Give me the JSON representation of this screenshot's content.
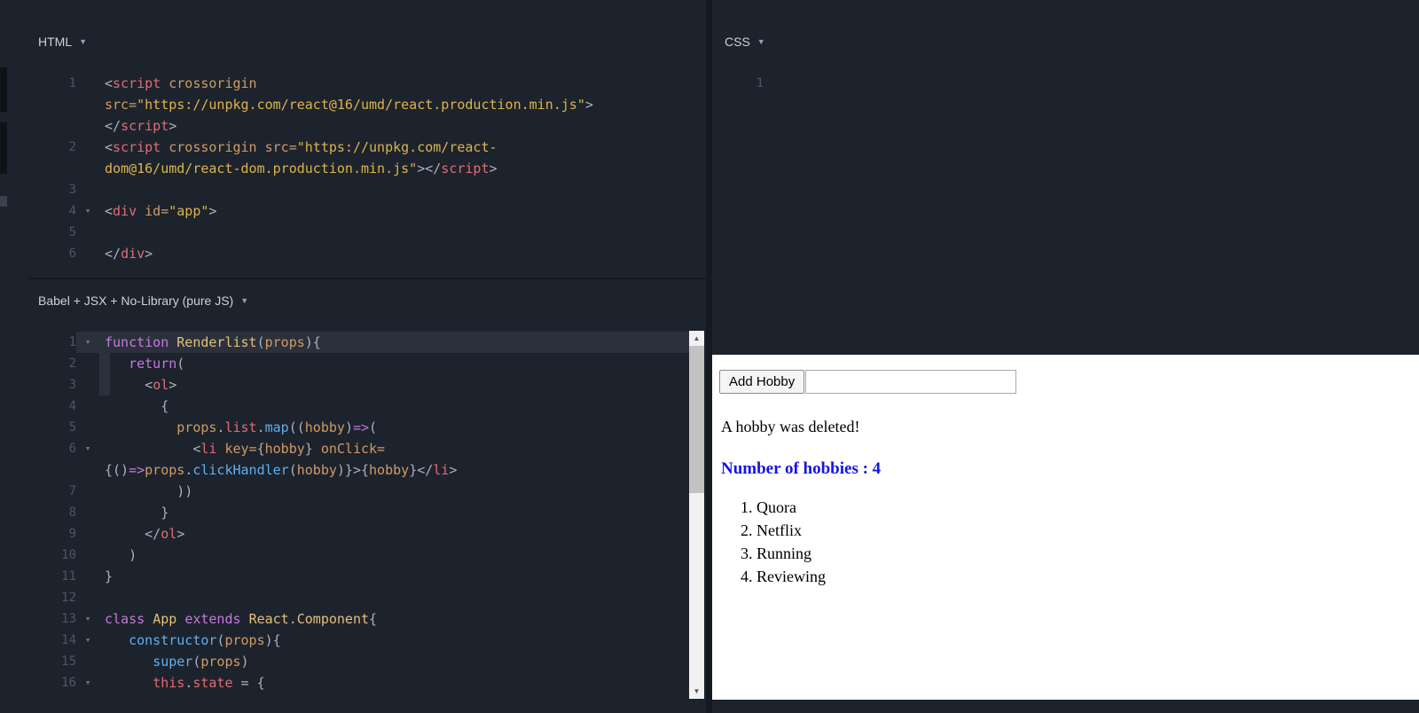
{
  "icons": {
    "dropdown": "▼",
    "fold": "▾",
    "scroll_up": "▲",
    "scroll_down": "▼"
  },
  "colors": {
    "count_text": "#1414e0",
    "syntax": {
      "pln": "#abb2bf",
      "tag": "#e06c75",
      "atr": "#d19a66",
      "str": "#ddb44d",
      "kw": "#c678dd",
      "def": "#e5c07b",
      "fn": "#61afef",
      "prop": "#e06c75"
    }
  },
  "panels": {
    "html": {
      "title": "HTML"
    },
    "css": {
      "title": "CSS"
    },
    "js": {
      "title": "Babel + JSX + No-Library (pure JS)"
    }
  },
  "editors": {
    "html": {
      "lines": [
        {
          "num": "1",
          "tokens": [
            [
              "pln",
              "<"
            ],
            [
              "tag",
              "script"
            ],
            [
              "pln",
              " "
            ],
            [
              "atr",
              "crossorigin"
            ]
          ]
        },
        {
          "num": "",
          "tokens": [
            [
              "atr",
              "src="
            ],
            [
              "str",
              "\"https://unpkg.com/react@16/umd/react.production.min.js\""
            ],
            [
              "pln",
              ">"
            ]
          ]
        },
        {
          "num": "",
          "tokens": [
            [
              "pln",
              "</"
            ],
            [
              "tag",
              "script"
            ],
            [
              "pln",
              ">"
            ]
          ]
        },
        {
          "num": "2",
          "tokens": [
            [
              "pln",
              "<"
            ],
            [
              "tag",
              "script"
            ],
            [
              "pln",
              " "
            ],
            [
              "atr",
              "crossorigin"
            ],
            [
              "pln",
              " "
            ],
            [
              "atr",
              "src="
            ],
            [
              "str",
              "\"https://unpkg.com/react-"
            ]
          ]
        },
        {
          "num": "",
          "tokens": [
            [
              "str",
              "dom@16/umd/react-dom.production.min.js\""
            ],
            [
              "pln",
              "></"
            ],
            [
              "tag",
              "script"
            ],
            [
              "pln",
              ">"
            ]
          ]
        },
        {
          "num": "3",
          "tokens": []
        },
        {
          "num": "4",
          "fold": true,
          "tokens": [
            [
              "pln",
              "<"
            ],
            [
              "tag",
              "div"
            ],
            [
              "pln",
              " "
            ],
            [
              "atr",
              "id="
            ],
            [
              "str",
              "\"app\""
            ],
            [
              "pln",
              ">"
            ]
          ]
        },
        {
          "num": "5",
          "tokens": []
        },
        {
          "num": "6",
          "tokens": [
            [
              "pln",
              "</"
            ],
            [
              "tag",
              "div"
            ],
            [
              "pln",
              ">"
            ]
          ]
        }
      ]
    },
    "css": {
      "lines": [
        {
          "num": "1",
          "tokens": []
        }
      ]
    },
    "js": {
      "lines": [
        {
          "num": "1",
          "fold": true,
          "active": true,
          "tokens": [
            [
              "kw",
              "function"
            ],
            [
              "pln",
              " "
            ],
            [
              "def",
              "Renderlist"
            ],
            [
              "pln",
              "("
            ],
            [
              "atr",
              "props"
            ],
            [
              "pln",
              "){"
            ]
          ]
        },
        {
          "num": "2",
          "sel": true,
          "tokens": [
            [
              "pln",
              "   "
            ],
            [
              "kw",
              "return"
            ],
            [
              "pln",
              "("
            ]
          ]
        },
        {
          "num": "3",
          "sel": true,
          "tokens": [
            [
              "pln",
              "     <"
            ],
            [
              "tag",
              "ol"
            ],
            [
              "pln",
              ">"
            ]
          ]
        },
        {
          "num": "4",
          "tokens": [
            [
              "pln",
              "       {"
            ]
          ]
        },
        {
          "num": "5",
          "tokens": [
            [
              "pln",
              "         "
            ],
            [
              "atr",
              "props"
            ],
            [
              "pln",
              "."
            ],
            [
              "prop",
              "list"
            ],
            [
              "pln",
              "."
            ],
            [
              "fn",
              "map"
            ],
            [
              "pln",
              "(("
            ],
            [
              "atr",
              "hobby"
            ],
            [
              "pln",
              ")"
            ],
            [
              "kw",
              "=>"
            ],
            [
              "pln",
              "("
            ]
          ]
        },
        {
          "num": "6",
          "fold": true,
          "tokens": [
            [
              "pln",
              "           <"
            ],
            [
              "tag",
              "li"
            ],
            [
              "pln",
              " "
            ],
            [
              "atr",
              "key="
            ],
            [
              "pln",
              "{"
            ],
            [
              "atr",
              "hobby"
            ],
            [
              "pln",
              "} "
            ],
            [
              "atr",
              "onClick="
            ]
          ]
        },
        {
          "num": "",
          "tokens": [
            [
              "pln",
              "{()"
            ],
            [
              "kw",
              "=>"
            ],
            [
              "atr",
              "props"
            ],
            [
              "pln",
              "."
            ],
            [
              "fn",
              "clickHandler"
            ],
            [
              "pln",
              "("
            ],
            [
              "atr",
              "hobby"
            ],
            [
              "pln",
              ")}>{"
            ],
            [
              "atr",
              "hobby"
            ],
            [
              "pln",
              "}</"
            ],
            [
              "tag",
              "li"
            ],
            [
              "pln",
              ">"
            ]
          ]
        },
        {
          "num": "7",
          "tokens": [
            [
              "pln",
              "         ))"
            ]
          ]
        },
        {
          "num": "8",
          "tokens": [
            [
              "pln",
              "       }"
            ]
          ]
        },
        {
          "num": "9",
          "tokens": [
            [
              "pln",
              "     </"
            ],
            [
              "tag",
              "ol"
            ],
            [
              "pln",
              ">"
            ]
          ]
        },
        {
          "num": "10",
          "tokens": [
            [
              "pln",
              "   )"
            ]
          ]
        },
        {
          "num": "11",
          "tokens": [
            [
              "pln",
              "}"
            ]
          ]
        },
        {
          "num": "12",
          "tokens": []
        },
        {
          "num": "13",
          "fold": true,
          "tokens": [
            [
              "kw",
              "class"
            ],
            [
              "pln",
              " "
            ],
            [
              "def",
              "App"
            ],
            [
              "pln",
              " "
            ],
            [
              "kw",
              "extends"
            ],
            [
              "pln",
              " "
            ],
            [
              "def",
              "React"
            ],
            [
              "pln",
              "."
            ],
            [
              "def",
              "Component"
            ],
            [
              "pln",
              "{"
            ]
          ]
        },
        {
          "num": "14",
          "fold": true,
          "tokens": [
            [
              "pln",
              "   "
            ],
            [
              "fn",
              "constructor"
            ],
            [
              "pln",
              "("
            ],
            [
              "atr",
              "props"
            ],
            [
              "pln",
              "){"
            ]
          ]
        },
        {
          "num": "15",
          "tokens": [
            [
              "pln",
              "      "
            ],
            [
              "fn",
              "super"
            ],
            [
              "pln",
              "("
            ],
            [
              "atr",
              "props"
            ],
            [
              "pln",
              ")"
            ]
          ]
        },
        {
          "num": "16",
          "fold": true,
          "tokens": [
            [
              "pln",
              "      "
            ],
            [
              "prop",
              "this"
            ],
            [
              "pln",
              "."
            ],
            [
              "prop",
              "state"
            ],
            [
              "pln",
              " = {"
            ]
          ]
        }
      ]
    }
  },
  "output": {
    "button_label": "Add Hobby",
    "input_value": "",
    "message": "A hobby was deleted!",
    "count_text": "Number of hobbies : 4",
    "list_items": [
      "Quora",
      "Netflix",
      "Running",
      "Reviewing"
    ]
  }
}
